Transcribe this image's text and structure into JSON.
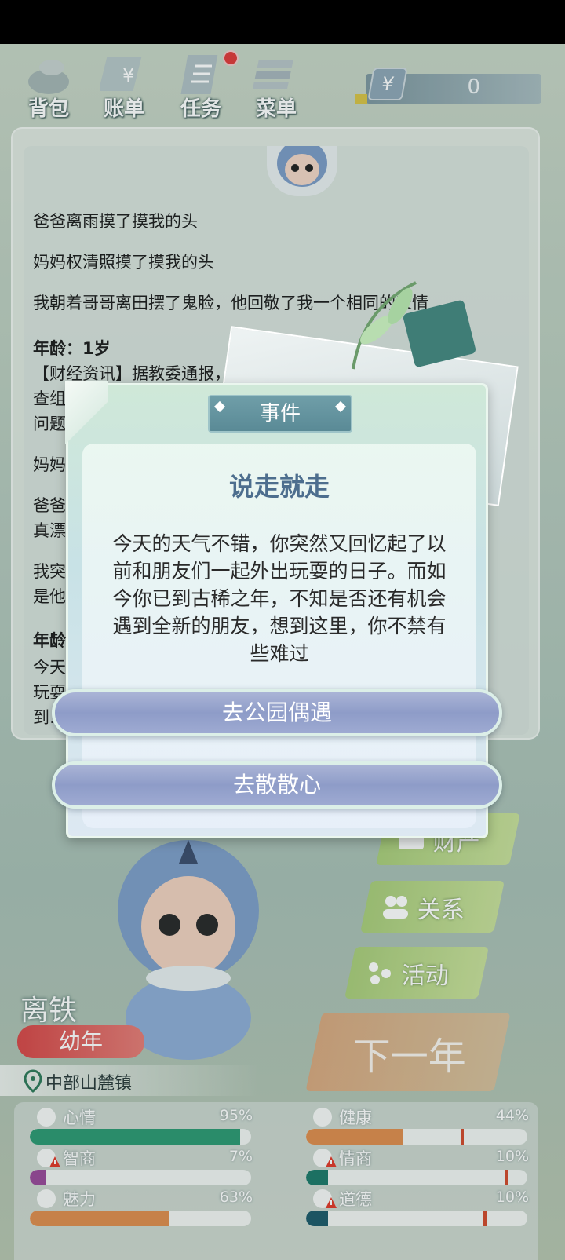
{
  "toolbar": {
    "items": [
      {
        "label": "背包",
        "icon": "bag-icon"
      },
      {
        "label": "账单",
        "icon": "bill-icon"
      },
      {
        "label": "任务",
        "icon": "task-icon",
        "badge": true
      },
      {
        "label": "菜单",
        "icon": "menu-icon"
      }
    ],
    "money": {
      "symbol": "¥",
      "value": "0"
    }
  },
  "log": {
    "lines": [
      {
        "text": "爸爸离雨摸了摸我的头"
      },
      {
        "text": "妈妈权清照摸了摸我的头"
      },
      {
        "text": "我朝着哥哥离田摆了鬼脸，他回敬了我一个相同的表情"
      },
      {
        "text": "年龄：1岁",
        "heading": true
      },
      {
        "text": "【财经资讯】据教委通报，……初级有……组织检"
      },
      {
        "text": "查组对……"
      },
      {
        "text": "问题……"
      },
      {
        "text": "妈妈……"
      },
      {
        "text": "爸爸……"
      },
      {
        "text": "真漂……"
      },
      {
        "text": "我突……定"
      },
      {
        "text": "是他……"
      },
      {
        "text": "年龄",
        "heading": true
      },
      {
        "text": "今天……出"
      },
      {
        "text": "玩耍……遇"
      },
      {
        "text": "到……"
      }
    ]
  },
  "side_menu": {
    "items": [
      {
        "label": "财产",
        "icon": "wallet-icon"
      },
      {
        "label": "关系",
        "icon": "people-icon"
      },
      {
        "label": "活动",
        "icon": "activity-icon"
      }
    ],
    "next_year": "下一年"
  },
  "character": {
    "name": "离铁",
    "stage": "幼年",
    "location": "中部山麓镇"
  },
  "stats": [
    {
      "name": "心情",
      "pct": "95%",
      "value": 0.95,
      "color": "#2e9a74",
      "icon": "smile-icon",
      "warn": false
    },
    {
      "name": "健康",
      "pct": "44%",
      "value": 0.44,
      "color": "#e08e4e",
      "icon": "heart-icon",
      "warn": false,
      "marker": 0.7
    },
    {
      "name": "智商",
      "pct": "7%",
      "value": 0.07,
      "color": "#9a4a9a",
      "icon": "brain-icon",
      "warn": true
    },
    {
      "name": "情商",
      "pct": "10%",
      "value": 0.1,
      "color": "#1e7a6a",
      "icon": "apple-icon",
      "warn": true,
      "marker": 0.9
    },
    {
      "name": "魅力",
      "pct": "63%",
      "value": 0.63,
      "color": "#e08e4e",
      "icon": "sparkle-icon",
      "warn": false
    },
    {
      "name": "道德",
      "pct": "10%",
      "value": 0.1,
      "color": "#1e5a6a",
      "icon": "scale-icon",
      "warn": true,
      "marker": 0.8
    }
  ],
  "dialog": {
    "tab": "事件",
    "title": "说走就走",
    "body": "今天的天气不错，你突然又回忆起了以前和朋友们一起外出玩耍的日子。而如今你已到古稀之年，不知是否还有机会遇到全新的朋友，想到这里，你不禁有些难过",
    "choices": [
      "去公园偶遇",
      "去散散心"
    ]
  }
}
